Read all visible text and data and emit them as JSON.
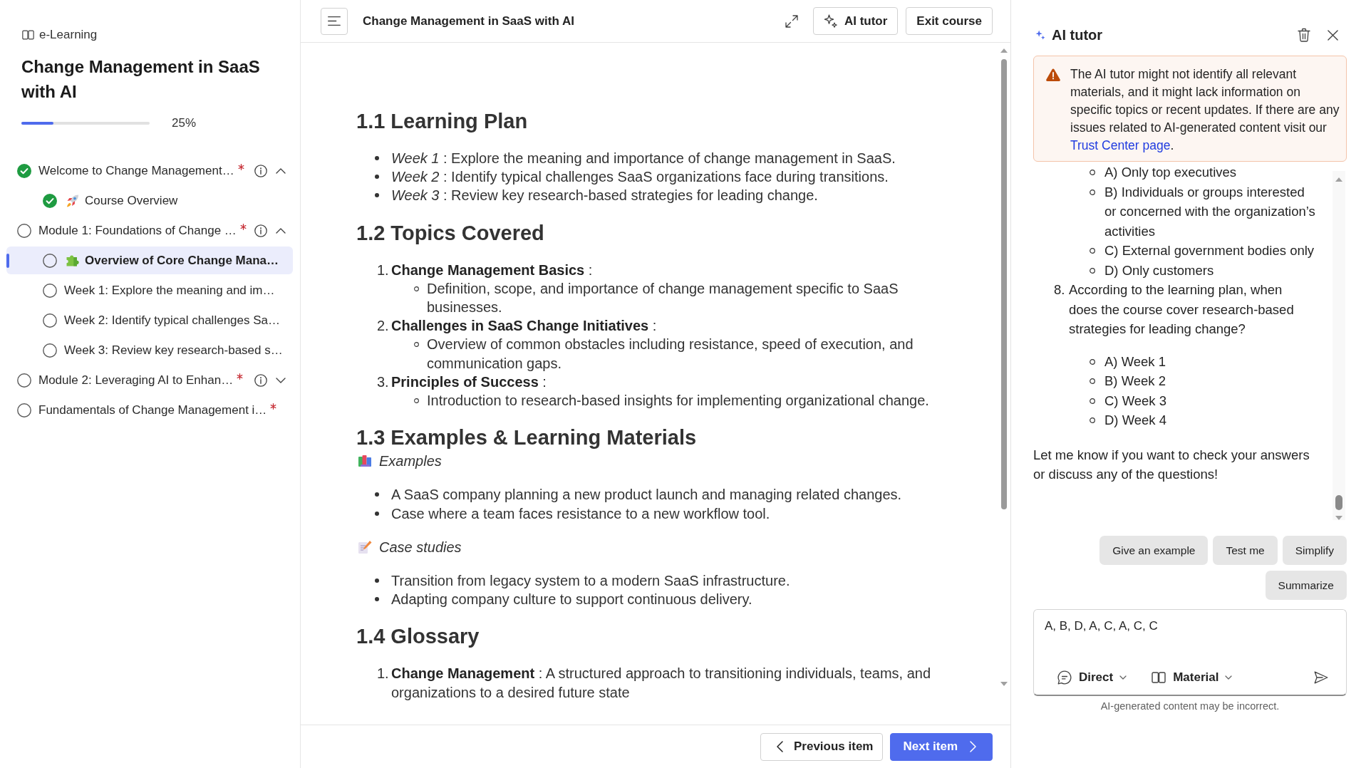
{
  "sidebar": {
    "brand": "e-Learning",
    "course_title": "Change Management in SaaS with AI",
    "progress": {
      "level": 0.25,
      "reading": "25%"
    },
    "outline": [
      {
        "label": "Welcome to Change Management…",
        "kind": "module",
        "completed": true,
        "required": true,
        "expanded": true,
        "selected": false,
        "children": [
          {
            "label": "Course Overview",
            "kind": "rocket",
            "completed": true,
            "required": false,
            "selected": false
          }
        ]
      },
      {
        "label": "Module 1: Foundations of Change …",
        "kind": "module",
        "completed": false,
        "required": true,
        "expanded": true,
        "selected": false,
        "children": [
          {
            "label": "Overview of Core Change Mana…",
            "kind": "puzzle",
            "completed": false,
            "required": false,
            "selected": true
          },
          {
            "label": "Week 1: Explore the meaning and im…",
            "kind": "page",
            "completed": false,
            "required": false,
            "selected": false
          },
          {
            "label": "Week 2: Identify typical challenges Sa…",
            "kind": "page",
            "completed": false,
            "required": false,
            "selected": false
          },
          {
            "label": "Week 3: Review key research-based s…",
            "kind": "page",
            "completed": false,
            "required": false,
            "selected": false
          }
        ]
      },
      {
        "label": "Module 2: Leveraging AI to Enhan…",
        "kind": "module",
        "completed": false,
        "required": true,
        "expanded": false,
        "selected": false
      },
      {
        "label": "Fundamentals of Change Management i…",
        "kind": "page",
        "completed": false,
        "required": true,
        "selected": false
      }
    ]
  },
  "header": {
    "title": "Change Management in SaaS with AI",
    "buttons": [
      {
        "label": "AI tutor",
        "kind": "sparkle"
      },
      {
        "label": "Exit course",
        "kind": "plain"
      }
    ]
  },
  "content": {
    "sections": [
      {
        "heading": "1.1 Learning Plan",
        "blocks": [
          {
            "kind": "bullets",
            "items": [
              "*Week 1* : Explore the meaning and importance of change management in SaaS.",
              "*Week 2* : Identify typical challenges SaaS organizations face during transitions.",
              "*Week 3* : Review key research-based strategies for leading change."
            ]
          }
        ]
      },
      {
        "heading": "1.2 Topics Covered",
        "blocks": [
          {
            "kind": "numbered",
            "items": [
              {
                "number": "1.",
                "text": "**Change Management Basics** :",
                "sub": [
                  "Definition, scope, and importance of change management specific to SaaS businesses."
                ]
              },
              {
                "number": "2.",
                "text": "**Challenges in SaaS Change Initiatives** :",
                "sub": [
                  "Overview of common obstacles including resistance, speed of execution, and communication gaps."
                ]
              },
              {
                "number": "3.",
                "text": "**Principles of Success** :",
                "sub": [
                  "Introduction to research-based insights for implementing organizational change."
                ]
              }
            ]
          }
        ]
      },
      {
        "heading": "1.3 Examples & Learning Materials",
        "blocks": [
          {
            "kind": "books",
            "text": "Examples"
          },
          {
            "kind": "bullets",
            "items": [
              "A SaaS company planning a new product launch and managing related changes.",
              "Case where a team faces resistance to a new workflow tool."
            ]
          },
          {
            "kind": "memo",
            "text": "Case studies"
          },
          {
            "kind": "bullets",
            "items": [
              "Transition from legacy system to a modern SaaS infrastructure.",
              "Adapting company culture to support continuous delivery."
            ]
          }
        ]
      },
      {
        "heading": "1.4 Glossary",
        "blocks": [
          {
            "kind": "numbered",
            "items": [
              {
                "number": "1.",
                "text": "**Change Management** : A structured approach to transitioning individuals, teams, and organizations to a desired future state"
              }
            ]
          }
        ]
      }
    ]
  },
  "footer": {
    "buttons": [
      {
        "label": "Previous item",
        "kind": "back"
      },
      {
        "label": "Next item",
        "kind": "next"
      }
    ]
  },
  "tutor": {
    "title": "AI tutor",
    "notice": {
      "text": "The AI tutor might not identify all relevant materials, and it might lack information on specific topics or recent updates. If there are any issues related to AI-generated content visit our",
      "link": "Trust Center page",
      "end": "."
    },
    "reply": {
      "questions": [
        {
          "options": [
            "A) Only top executives",
            "B) Individuals or groups interested or concerned with the organization’s activities",
            "C) External government bodies only",
            "D) Only customers"
          ]
        },
        {
          "number": "8.",
          "text": "According to the learning plan, when does the course cover research-based strategies for leading change?",
          "options": [
            "A) Week 1",
            "B) Week 2",
            "C) Week 3",
            "D) Week 4"
          ]
        }
      ],
      "closing": "Let me know if you want to check your answers or discuss any of the questions!"
    },
    "suggestions": [
      "Give an example",
      "Test me",
      "Simplify",
      "Summarize"
    ],
    "composer": {
      "value": "A, B, D, A, C, A, C, C",
      "dropdowns": [
        {
          "label": "Direct",
          "kind": "chat"
        },
        {
          "label": "Material",
          "kind": "book"
        }
      ]
    },
    "disclaimer": "AI-generated content may be incorrect."
  }
}
